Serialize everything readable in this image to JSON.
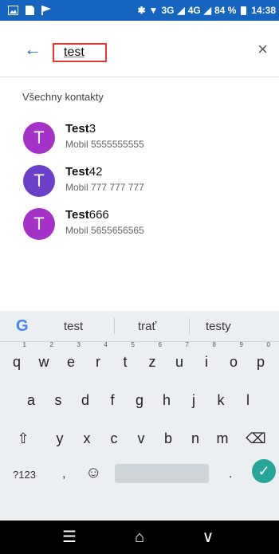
{
  "status_bar": {
    "left_icons": [
      "image-icon",
      "sim-icon",
      "flag-icon"
    ],
    "network": "3G",
    "network2": "4G",
    "battery": "84 %",
    "time": "14:38"
  },
  "search": {
    "back_icon": "←",
    "query": "test",
    "close_icon": "×"
  },
  "list": {
    "section_title": "Všechny kontakty",
    "contacts": [
      {
        "initial": "T",
        "name_bold": "Test",
        "name_rest": "3",
        "phone": "Mobil 5555555555",
        "color": "#a531c8"
      },
      {
        "initial": "T",
        "name_bold": "Test",
        "name_rest": "42",
        "phone": "Mobil 777 777 777",
        "color": "#6a3fc9"
      },
      {
        "initial": "T",
        "name_bold": "Test",
        "name_rest": "666",
        "phone": "Mobil 5655656565",
        "color": "#a531c8"
      }
    ]
  },
  "keyboard": {
    "google": "G",
    "suggestions": [
      "test",
      "trať",
      "testy"
    ],
    "row1": [
      {
        "k": "q",
        "n": "1"
      },
      {
        "k": "w",
        "n": "2"
      },
      {
        "k": "e",
        "n": "3"
      },
      {
        "k": "r",
        "n": "4"
      },
      {
        "k": "t",
        "n": "5"
      },
      {
        "k": "z",
        "n": "6"
      },
      {
        "k": "u",
        "n": "7"
      },
      {
        "k": "i",
        "n": "8"
      },
      {
        "k": "o",
        "n": "9"
      },
      {
        "k": "p",
        "n": "0"
      }
    ],
    "row2": [
      "a",
      "s",
      "d",
      "f",
      "g",
      "h",
      "j",
      "k",
      "l"
    ],
    "row3": [
      "y",
      "x",
      "c",
      "v",
      "b",
      "n",
      "m"
    ],
    "shift_icon": "⇧",
    "backspace_icon": "⌫",
    "sym_label": "?123",
    "comma": ",",
    "emoji_icon": "☺",
    "period": ".",
    "enter_icon": "✓"
  },
  "navbar": {
    "menu_icon": "☰",
    "home_icon": "⌂",
    "back_icon": "∨"
  }
}
